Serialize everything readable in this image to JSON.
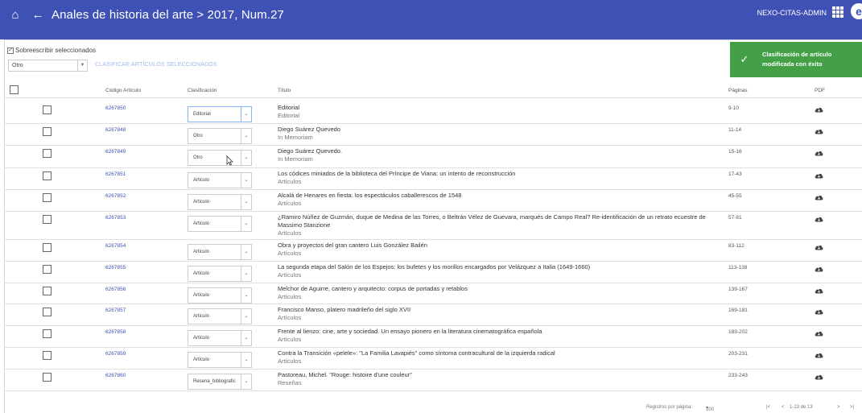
{
  "header": {
    "title": "Anales de historia del arte > 2017, Num.27",
    "user": "NEXO-CITAS-ADMIN",
    "account_letter": "e"
  },
  "controls": {
    "overwrite_label": "Sobreescribir seleccionados",
    "bulk_value": "Otro",
    "classify_button": "CLASIFICAR ARTÍCULOS SELECCIONADOS"
  },
  "toast": {
    "line1": "Clasificación de artículo",
    "line2": "modificada con éxito"
  },
  "table": {
    "headers": {
      "code": "Código Artículo",
      "classification": "Clasificación",
      "title": "Título",
      "pages": "Páginas",
      "pdf": "PDF"
    },
    "rows": [
      {
        "code": "6267850",
        "classification": "Editorial",
        "title": "Editorial",
        "subtitle": "Editorial",
        "pages": "9-10"
      },
      {
        "code": "6267848",
        "classification": "Otro",
        "title": "Diego Suárez Quevedo",
        "subtitle": "In Memoriam",
        "pages": "11-14"
      },
      {
        "code": "6267849",
        "classification": "Otro",
        "title": "Diego Suárez Quevedo.",
        "subtitle": "In Memoriam",
        "pages": "15-16"
      },
      {
        "code": "6267851",
        "classification": "Articulo",
        "title": "Los códices miniados de la biblioteca del Príncipe de Viana: un intento de reconstrucción",
        "subtitle": "Artículos",
        "pages": "17-43"
      },
      {
        "code": "6267852",
        "classification": "Articulo",
        "title": "Alcalá de Henares en fiesta: los espectáculos caballerescos de 1548",
        "subtitle": "Artículos",
        "pages": "45-55"
      },
      {
        "code": "6267853",
        "classification": "Articulo",
        "title": "¿Ramiro Núñez de Guzmán, duque de Medina de las Torres, o Beltrán Vélez de Guevara, marqués de Campo Real? Re-identificación de un retrato ecuestre de Massimo Stanzione",
        "subtitle": "Artículos",
        "pages": "57-81"
      },
      {
        "code": "6267854",
        "classification": "Articulo",
        "title": "Obra y proyectos del gran cantero Luis González Bailén",
        "subtitle": "Artículos",
        "pages": "83-112"
      },
      {
        "code": "6267855",
        "classification": "Articulo",
        "title": "La segunda etapa del Salón de los Espejos: los bufetes y los morillos encargados por Velázquez a Italia (1649-1660)",
        "subtitle": "Artículos",
        "pages": "113-138"
      },
      {
        "code": "6267856",
        "classification": "Articulo",
        "title": "Melchor de Aguirre, cantero y arquitecto: corpus de portadas y retablos",
        "subtitle": "Artículos",
        "pages": "139-167"
      },
      {
        "code": "6267857",
        "classification": "Articulo",
        "title": "Francisco Manso, platero madrileño del siglo XVII",
        "subtitle": "Artículos",
        "pages": "169-181"
      },
      {
        "code": "6267858",
        "classification": "Articulo",
        "title": "Frente al lienzo: cine, arte y sociedad. Un ensayo pionero en la literatura cinematográfica española",
        "subtitle": "Artículos",
        "pages": "183-202"
      },
      {
        "code": "6267859",
        "classification": "Articulo",
        "title": "Contra la Transición «pelele»: \"La Familia Lavapiés\" como síntoma contracultural de la izquierda radical",
        "subtitle": "Artículos",
        "pages": "203-231"
      },
      {
        "code": "6267860",
        "classification": "Resena_bibliografic",
        "title": "Pastoreau, Michel. \"Rouge: histoire d'une couleur\"",
        "subtitle": "Reseñas",
        "pages": "233-243"
      }
    ]
  },
  "footer": {
    "rows_per_page_label": "Registros por página:",
    "rows_per_page": "200",
    "range": "1-13 de 13"
  },
  "colors": {
    "topbar": "#3f51b5",
    "toast": "#43a047",
    "link": "#3f51b5"
  },
  "icons": [
    "home-icon",
    "back-arrow-icon",
    "apps-grid-icon",
    "account-icon",
    "check-icon",
    "cloud-download-icon",
    "first-page-icon",
    "prev-page-icon",
    "next-page-icon",
    "last-page-icon",
    "mouse-cursor-icon"
  ]
}
